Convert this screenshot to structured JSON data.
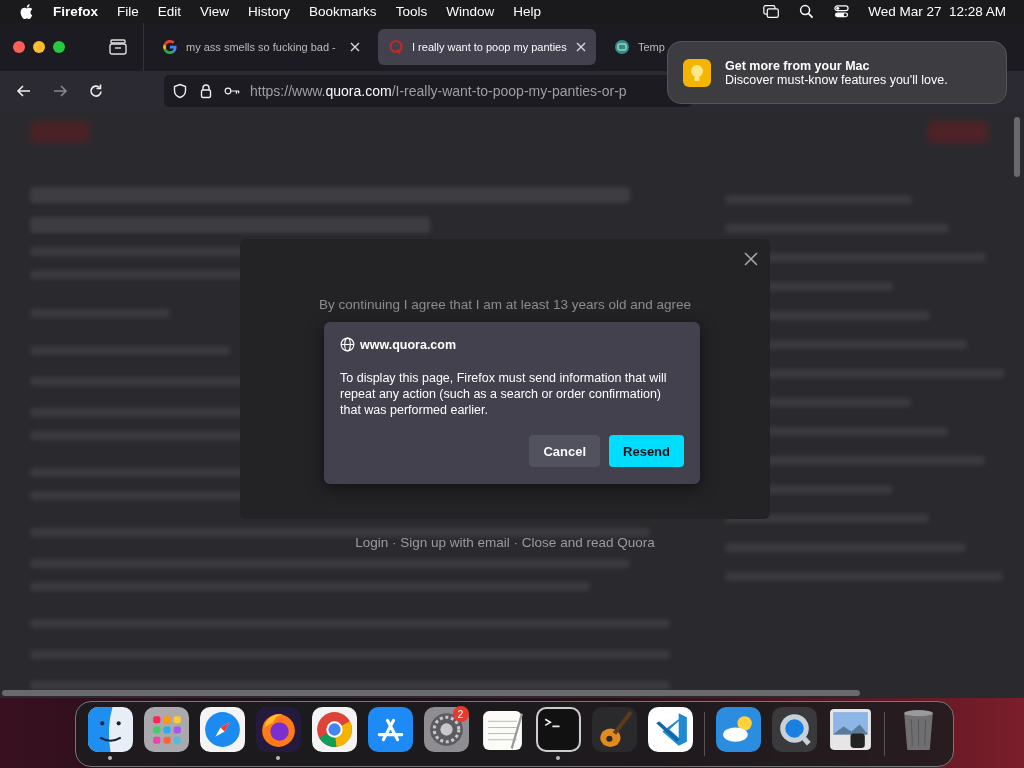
{
  "menu_bar": {
    "app": "Firefox",
    "menus": [
      "File",
      "Edit",
      "View",
      "History",
      "Bookmarks",
      "Tools",
      "Window",
      "Help"
    ],
    "clock": "Wed Mar 27  12:28 AM"
  },
  "tabs": [
    {
      "title": "my ass smells so fucking bad -",
      "kind": "google",
      "selected": false,
      "closable": true
    },
    {
      "title": "I really want to poop my panties",
      "kind": "quora",
      "selected": true,
      "closable": true
    },
    {
      "title": "Temp",
      "kind": "temp",
      "selected": false,
      "closable": false
    }
  ],
  "notification": {
    "title": "Get more from your Mac",
    "body": "Discover must-know features you'll love."
  },
  "address_bar": {
    "prefix": "https://www.",
    "host": "quora.com",
    "path": "/I-really-want-to-poop-my-panties-or-p"
  },
  "page": {
    "consent_text": "By continuing I agree that I am at least 13 years old and agree",
    "footer_links": "Login · Sign up with email · Close and read Quora"
  },
  "dialog": {
    "site": "www.quora.com",
    "message": "To display this page, Firefox must send information that will repeat any action (such as a search or order confirmation) that was performed earlier.",
    "buttons": [
      {
        "label": "Cancel",
        "kind": "secondary"
      },
      {
        "label": "Resend",
        "kind": "primary"
      }
    ]
  },
  "dock": [
    {
      "kind": "finder",
      "running": true
    },
    {
      "kind": "launchpad",
      "running": false
    },
    {
      "kind": "safari",
      "running": false
    },
    {
      "kind": "firefox",
      "running": true
    },
    {
      "kind": "chrome",
      "running": false
    },
    {
      "kind": "appstore",
      "running": false
    },
    {
      "kind": "settings",
      "running": false,
      "badge": "2"
    },
    {
      "kind": "textedit",
      "running": false
    },
    {
      "kind": "terminal",
      "running": true
    },
    {
      "kind": "garageband",
      "running": false
    },
    {
      "kind": "vscode",
      "running": false
    },
    {
      "kind": "separator"
    },
    {
      "kind": "weather",
      "running": false
    },
    {
      "kind": "quicktime",
      "running": false
    },
    {
      "kind": "preview",
      "running": false
    },
    {
      "kind": "separator"
    },
    {
      "kind": "trash",
      "running": false
    }
  ]
}
